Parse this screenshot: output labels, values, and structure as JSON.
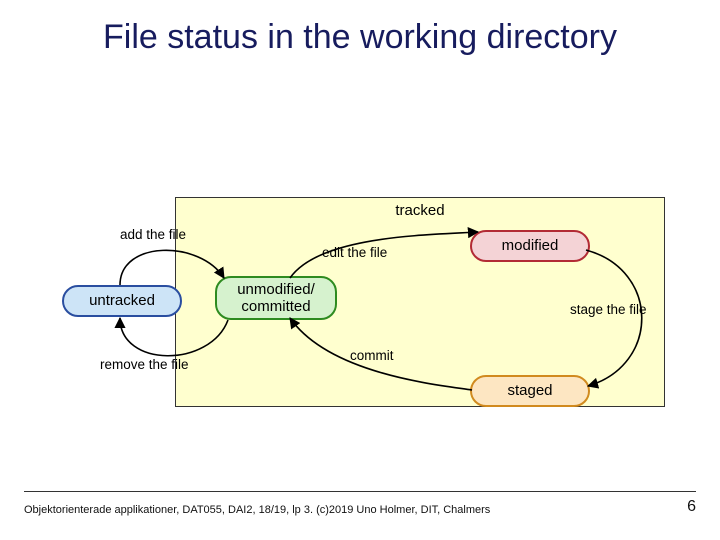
{
  "title": "File status in the working directory",
  "tracked_label": "tracked",
  "states": {
    "untracked": "untracked",
    "unmodified": "unmodified/\ncommitted",
    "modified": "modified",
    "staged": "staged"
  },
  "edges": {
    "add": "add the file",
    "edit": "edit the file",
    "remove": "remove the file",
    "commit": "commit",
    "stage": "stage the file"
  },
  "footer": "Objektorienterade applikationer, DAT055, DAI2, 18/19, lp 3. (c)2019 Uno Holmer, DIT, Chalmers",
  "page_number": "6"
}
